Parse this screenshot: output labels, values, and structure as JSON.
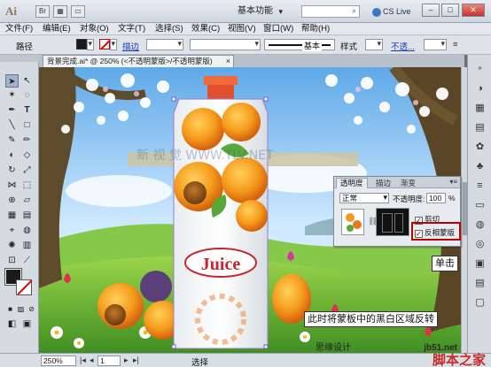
{
  "titlebar": {
    "app_logo": "Ai",
    "workspace": "基本功能",
    "cslive": "CS Live",
    "window_buttons": [
      "–",
      "□",
      "✕"
    ]
  },
  "menu": [
    "文件(F)",
    "编辑(E)",
    "对象(O)",
    "文字(T)",
    "选择(S)",
    "效果(C)",
    "视图(V)",
    "窗口(W)",
    "帮助(H)"
  ],
  "control_bar": {
    "selection_label": "路径",
    "stroke_link": "描边",
    "stroke_style": "基本",
    "style_label": "样式",
    "opacity_link": "不透..."
  },
  "document": {
    "tab_title": "背景完成.ai* @ 250% (<不透明蒙版>/不透明蒙版)",
    "close": "×"
  },
  "transparency_panel": {
    "tabs": [
      "透明度",
      "描边",
      "渐变"
    ],
    "blend_mode": "正常",
    "opacity_label": "不透明度:",
    "opacity_value": "100",
    "opacity_unit": "%",
    "clip_label": "剪切",
    "invert_label": "反相蒙版",
    "clip_checked": true,
    "invert_checked": true
  },
  "callouts": {
    "click": "单击",
    "note": "此时将蒙板中的黑白区域反转"
  },
  "artwork": {
    "logo_text": "Juice"
  },
  "status_bar": {
    "zoom": "250%",
    "page": "1",
    "status_text": "选择"
  },
  "watermark": {
    "url": "jb51.net",
    "brand": "脚本之家",
    "overlay": "思缘设计"
  },
  "colors": {
    "accent_red": "#c00000",
    "juice_red": "#c8262e",
    "sky": "#9fd3ff",
    "grass": "#6fbb3a"
  }
}
